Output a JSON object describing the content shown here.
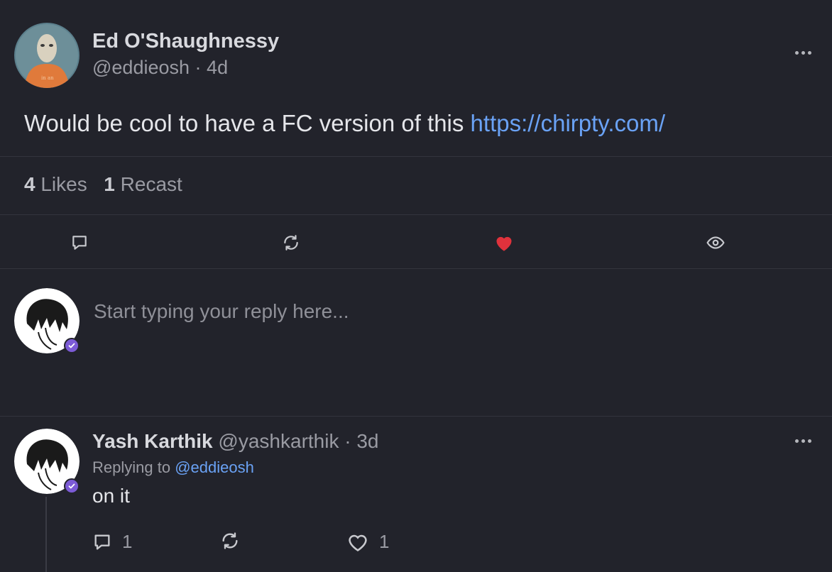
{
  "post": {
    "author_name": "Ed O'Shaughnessy",
    "handle": "@eddieosh",
    "sep": "·",
    "time": "4d",
    "text": "Would be cool to have a FC version of this ",
    "link": "https://chirpty.com/",
    "likes_count": "4",
    "likes_label": "Likes",
    "recasts_count": "1",
    "recasts_label": "Recast"
  },
  "actions": {
    "icons": [
      "comment-icon",
      "recast-icon",
      "heart-icon",
      "eye-icon"
    ],
    "heart_color": "#e0323c"
  },
  "reply_box": {
    "placeholder": "Start typing your reply here..."
  },
  "reply": {
    "author_name": "Yash Karthik",
    "handle": "@yashkarthik",
    "sep": "·",
    "time": "3d",
    "replying_prefix": "Replying to ",
    "replying_handle": "@eddieosh",
    "text": "on it",
    "comments_count": "1",
    "likes_count": "1"
  },
  "colors": {
    "background": "#22232b",
    "link": "#6aa2f5",
    "verified_badge": "#7c5bd6"
  }
}
